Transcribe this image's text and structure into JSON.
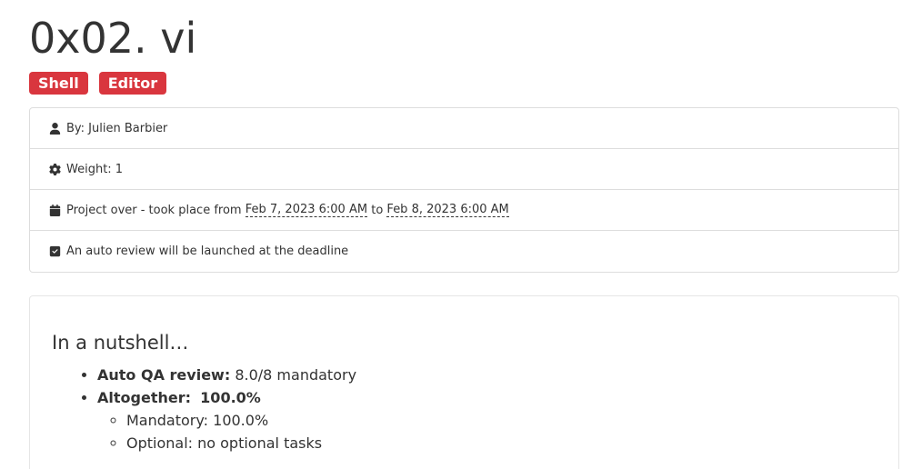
{
  "project": {
    "title": "0x02. vi",
    "tags": [
      "Shell",
      "Editor"
    ]
  },
  "meta": {
    "author": "By: Julien Barbier",
    "weight": "Weight: 1",
    "dates_prefix": "Project over - took place from",
    "start_date": "Feb 7, 2023 6:00 AM",
    "dates_joiner": "to",
    "end_date": "Feb 8, 2023 6:00 AM",
    "auto_review": "An auto review will be launched at the deadline",
    "icons": [
      "user-icon",
      "gear-icon",
      "calendar-icon",
      "checkbox-icon"
    ]
  },
  "nutshell": {
    "title": "In a nutshell…",
    "qa_label": "Auto QA review:",
    "qa_value": "8.0/8 mandatory",
    "altogether_label": "Altogether:",
    "altogether_value": "100.0%",
    "mandatory": "Mandatory: 100.0%",
    "optional": "Optional: no optional tasks"
  },
  "colors": {
    "tag_background": "#d9363e",
    "text": "#333333",
    "border": "#dddddd"
  }
}
